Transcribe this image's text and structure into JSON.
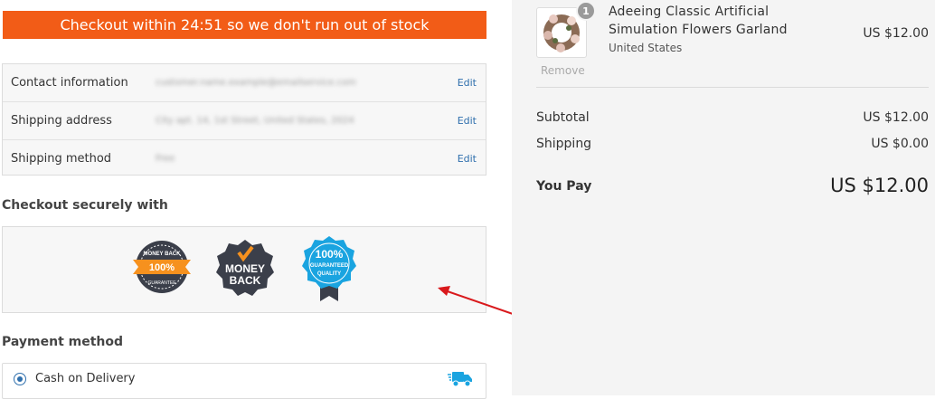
{
  "banner": {
    "text": "Checkout within 24:51 so we don't run out of stock"
  },
  "info": {
    "rows": [
      {
        "label": "Contact information",
        "value": "customer.name.example@emailservice.com",
        "edit": "Edit"
      },
      {
        "label": "Shipping address",
        "value": "City apt. 14, 1st Street, United States, 2024",
        "edit": "Edit"
      },
      {
        "label": "Shipping method",
        "value": "Free",
        "edit": "Edit"
      }
    ]
  },
  "checkout_secure": {
    "title": "Checkout securely with"
  },
  "badges": {
    "badge1_top": "MONEY BACK",
    "badge1_center": "100%",
    "badge1_bottom": "GUARANTEE",
    "badge2_line1": "MONEY",
    "badge2_line2": "BACK",
    "badge3_line1": "100%",
    "badge3_line2": "GUARANTEED",
    "badge3_line3": "QUALITY"
  },
  "payment": {
    "title": "Payment method",
    "option_label": "Cash on Delivery"
  },
  "summary": {
    "qty": "1",
    "remove": "Remove",
    "product_title": "Adeeing Classic Artificial Simulation Flowers Garland",
    "product_country": "United States",
    "product_price": "US $12.00",
    "subtotal_label": "Subtotal",
    "subtotal_value": "US $12.00",
    "shipping_label": "Shipping",
    "shipping_value": "US $0.00",
    "youpay_label": "You Pay",
    "youpay_value": "US $12.00"
  },
  "colors": {
    "banner": "#f25c17",
    "link": "#2f6fad",
    "arrow": "#d9191c",
    "badge_orange": "#f6911e",
    "badge_blue": "#1aa4e0",
    "badge_dark": "#3b3f4a"
  }
}
